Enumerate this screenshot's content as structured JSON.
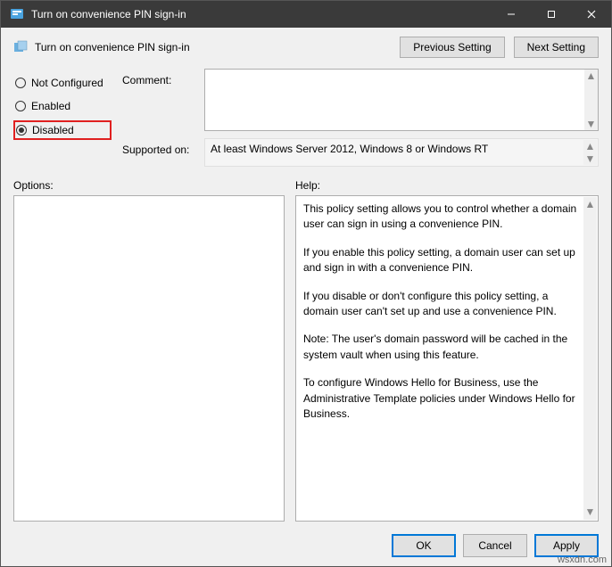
{
  "titlebar": {
    "text": "Turn on convenience PIN sign-in"
  },
  "header": {
    "title": "Turn on convenience PIN sign-in",
    "prev": "Previous Setting",
    "next": "Next Setting"
  },
  "radios": {
    "not_configured": "Not Configured",
    "enabled": "Enabled",
    "disabled": "Disabled",
    "selected": "disabled"
  },
  "labels": {
    "comment": "Comment:",
    "supported": "Supported on:",
    "options": "Options:",
    "help": "Help:"
  },
  "comment": "",
  "supported_on": "At least Windows Server 2012, Windows 8 or Windows RT",
  "help": {
    "p1": "This policy setting allows you to control whether a domain user can sign in using a convenience PIN.",
    "p2": "If you enable this policy setting, a domain user can set up and sign in with a convenience PIN.",
    "p3": "If you disable or don't configure this policy setting, a domain user can't set up and use a convenience PIN.",
    "p4": "Note: The user's domain password will be cached in the system vault when using this feature.",
    "p5": "To configure Windows Hello for Business, use the Administrative Template policies under Windows Hello for Business."
  },
  "buttons": {
    "ok": "OK",
    "cancel": "Cancel",
    "apply": "Apply"
  },
  "source": "wsxdn.com"
}
